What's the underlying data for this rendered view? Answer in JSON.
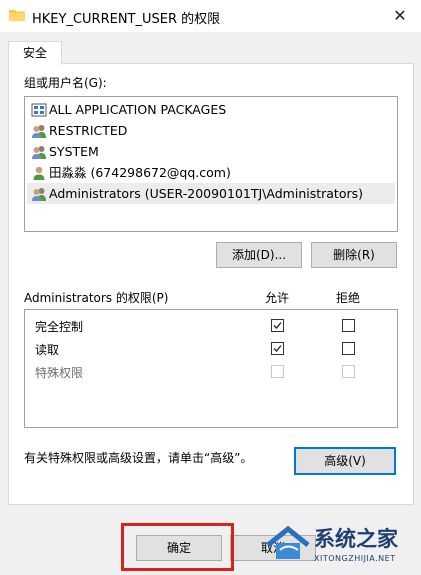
{
  "window": {
    "title": "HKEY_CURRENT_USER 的权限",
    "close_glyph": "✕"
  },
  "tabs": [
    {
      "label": "安全"
    }
  ],
  "groups": {
    "label": "组或用户名(G):",
    "items": [
      {
        "name": "ALL APPLICATION PACKAGES",
        "icon": "package-icon"
      },
      {
        "name": "RESTRICTED",
        "icon": "group-icon"
      },
      {
        "name": "SYSTEM",
        "icon": "group-icon"
      },
      {
        "name": "田淼淼 (674298672@qq.com)",
        "icon": "user-icon"
      },
      {
        "name": "Administrators (USER-20090101TJ\\Administrators)",
        "icon": "group-icon",
        "selected": true
      }
    ]
  },
  "buttons": {
    "add": "添加(D)...",
    "remove": "删除(R)",
    "advanced": "高级(V)",
    "ok": "确定",
    "cancel": "取消"
  },
  "permissions": {
    "label": "Administrators 的权限(P)",
    "col_allow": "允许",
    "col_deny": "拒绝",
    "rows": [
      {
        "name": "完全控制",
        "allow": true,
        "deny": false,
        "disabled": false
      },
      {
        "name": "读取",
        "allow": true,
        "deny": false,
        "disabled": false
      },
      {
        "name": "特殊权限",
        "allow": false,
        "deny": false,
        "disabled": true
      }
    ]
  },
  "advanced_hint": "有关特殊权限或高级设置，请单击“高级”。",
  "watermark": {
    "brand": "系统之家",
    "url": "XITONGZHIJIA.NET"
  },
  "colors": {
    "highlight": "#d9221c",
    "focus": "#0078d7",
    "selection": "#ececec"
  }
}
